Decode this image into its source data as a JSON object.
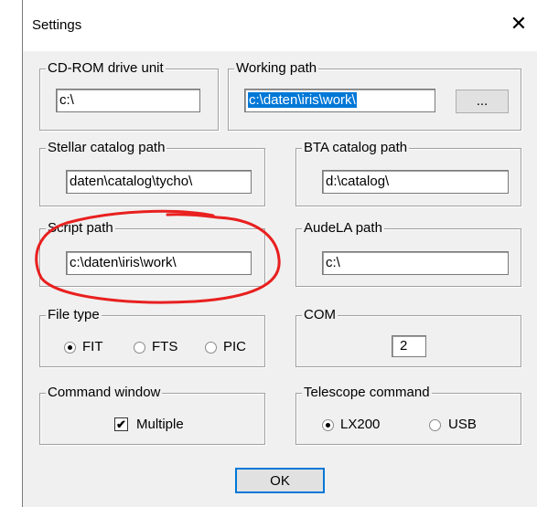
{
  "window": {
    "title": "Settings",
    "close_glyph": "✕"
  },
  "groups": {
    "cdrom": {
      "label": "CD-ROM drive unit",
      "value": "c:\\"
    },
    "working": {
      "label": "Working path",
      "value": "c:\\daten\\iris\\work\\",
      "browse_label": "..."
    },
    "stellar": {
      "label": "Stellar catalog path",
      "value": "daten\\catalog\\tycho\\"
    },
    "bta": {
      "label": "BTA catalog path",
      "value": "d:\\catalog\\"
    },
    "script": {
      "label": "Script path",
      "value": "c:\\daten\\iris\\work\\"
    },
    "audela": {
      "label": "AudeLA path",
      "value": "c:\\"
    },
    "filetype": {
      "label": "File type",
      "options": [
        "FIT",
        "FTS",
        "PIC"
      ],
      "selected": "FIT"
    },
    "com": {
      "label": "COM",
      "value": "2"
    },
    "cmdwin": {
      "label": "Command window",
      "checkbox_label": "Multiple",
      "checked": true,
      "check_glyph": "✔"
    },
    "telescope": {
      "label": "Telescope command",
      "options": [
        "LX200",
        "USB"
      ],
      "selected": "LX200"
    }
  },
  "ok_label": "OK",
  "annotation": {
    "color": "#e8201f",
    "shape": "red-ellipse-highlight"
  }
}
